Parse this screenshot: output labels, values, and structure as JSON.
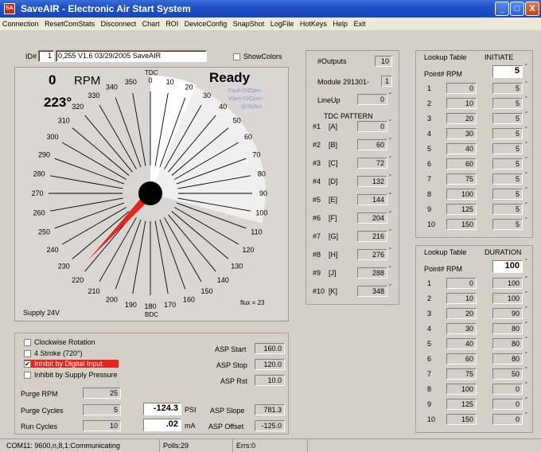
{
  "window": {
    "title": "SaveAIR - Electronic Air Start System",
    "icon_label": "SA",
    "min": "_",
    "max": "□",
    "close": "X"
  },
  "menu": [
    "Connection",
    "ResetComStats",
    "Disconnect",
    "Chart",
    "ROI",
    "DeviceConfig",
    "SnapShot",
    "LogFile",
    "HotKeys",
    "Help",
    "Exit"
  ],
  "id_label": "ID#",
  "id_value": "1",
  "version": "0,255 V1.6 03/29/2005 SaveAIR",
  "show_colors": "ShowColors",
  "gauge": {
    "rpm_value": "0",
    "rpm_label": "RPM",
    "angle": "223°",
    "status": "Ready",
    "alerts": [
      "Fault-DIOpen",
      "Warn-DIOpen",
      "@Stylus"
    ],
    "supply": "Supply 24V",
    "tdc": "TDC",
    "bdc": "BDC",
    "flux": "flux = 23",
    "tick_labels": [
      "0",
      "10",
      "20",
      "30",
      "40",
      "50",
      "60",
      "70",
      "80",
      "90",
      "100",
      "110",
      "120",
      "130",
      "140",
      "150",
      "160",
      "170",
      "180",
      "190",
      "200",
      "210",
      "220",
      "230",
      "240",
      "250",
      "260",
      "270",
      "280",
      "290",
      "300",
      "310",
      "320",
      "330",
      "340",
      "350"
    ],
    "initiate_deg": 5,
    "duration_deg": 100,
    "pointer_deg": 223
  },
  "options": {
    "clockwise": "Clockwise Rotation",
    "stroke": "4 Stroke (720°)",
    "inhibit_di": "Inhibit by Digital Input",
    "inhibit_supply": "Inhibit by Supply Pressure",
    "inhibit_checked": "✔"
  },
  "purge": [
    {
      "label": "Purge RPM",
      "value": "25"
    },
    {
      "label": "Purge Cycles",
      "value": "5"
    },
    {
      "label": "Run Cycles",
      "value": "10"
    }
  ],
  "psi": {
    "value": "-124.3",
    "unit": "PSI"
  },
  "ma": {
    "value": ".02",
    "unit": "mA"
  },
  "asp": [
    {
      "label": "ASP Start",
      "value": "160.0"
    },
    {
      "label": "ASP Stop",
      "value": "120.0"
    },
    {
      "label": "ASP Rst",
      "value": "10.0"
    }
  ],
  "asp2": [
    {
      "label": "ASP Slope",
      "value": "781.3"
    },
    {
      "label": "ASP Offset",
      "value": "-125.0"
    }
  ],
  "outputs": {
    "label": "#Outputs",
    "value": "10",
    "module_label": "Module 291301-",
    "module_value": "1",
    "lineup_label": "LineUp",
    "lineup_value": "0",
    "pattern_title": "TDC  PATTERN"
  },
  "pattern": [
    {
      "n": "#1",
      "l": "[A]",
      "v": "0"
    },
    {
      "n": "#2",
      "l": "[B]",
      "v": "60"
    },
    {
      "n": "#3",
      "l": "[C]",
      "v": "72"
    },
    {
      "n": "#4",
      "l": "[D]",
      "v": "132"
    },
    {
      "n": "#5",
      "l": "[E]",
      "v": "144"
    },
    {
      "n": "#6",
      "l": "[F]",
      "v": "204"
    },
    {
      "n": "#7",
      "l": "[G]",
      "v": "216"
    },
    {
      "n": "#8",
      "l": "[H]",
      "v": "276"
    },
    {
      "n": "#9",
      "l": "[J]",
      "v": "288"
    },
    {
      "n": "#10",
      "l": "[K]",
      "v": "348"
    }
  ],
  "initiate": {
    "title": "Lookup Table",
    "name": "INITIATE",
    "hdr": "Point#  RPM",
    "value": "5",
    "rows": [
      {
        "p": "1",
        "rpm": "0",
        "v": "5"
      },
      {
        "p": "2",
        "rpm": "10",
        "v": "5"
      },
      {
        "p": "3",
        "rpm": "20",
        "v": "5"
      },
      {
        "p": "4",
        "rpm": "30",
        "v": "5"
      },
      {
        "p": "5",
        "rpm": "40",
        "v": "5"
      },
      {
        "p": "6",
        "rpm": "60",
        "v": "5"
      },
      {
        "p": "7",
        "rpm": "75",
        "v": "5"
      },
      {
        "p": "8",
        "rpm": "100",
        "v": "5"
      },
      {
        "p": "9",
        "rpm": "125",
        "v": "5"
      },
      {
        "p": "10",
        "rpm": "150",
        "v": "5"
      }
    ]
  },
  "duration": {
    "title": "Lookup Table",
    "name": "DURATION",
    "hdr": "Point#  RPM",
    "value": "100",
    "rows": [
      {
        "p": "1",
        "rpm": "0",
        "v": "100"
      },
      {
        "p": "2",
        "rpm": "10",
        "v": "100"
      },
      {
        "p": "3",
        "rpm": "20",
        "v": "90"
      },
      {
        "p": "4",
        "rpm": "30",
        "v": "80"
      },
      {
        "p": "5",
        "rpm": "40",
        "v": "80"
      },
      {
        "p": "6",
        "rpm": "60",
        "v": "80"
      },
      {
        "p": "7",
        "rpm": "75",
        "v": "50"
      },
      {
        "p": "8",
        "rpm": "100",
        "v": "0"
      },
      {
        "p": "9",
        "rpm": "125",
        "v": "0"
      },
      {
        "p": "10",
        "rpm": "150",
        "v": "0"
      }
    ]
  },
  "statusbar": {
    "com": "COM11: 9600,n,8,1:Communicating",
    "polls": "Polls:29",
    "errs": "Errs:0"
  }
}
